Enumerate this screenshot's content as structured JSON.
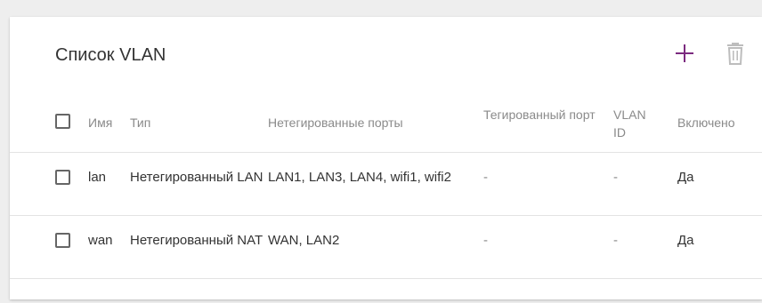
{
  "title": "Список VLAN",
  "actions": {
    "add": "plus-icon",
    "delete": "trash-icon",
    "accent_color": "#7b2a7f",
    "disabled_color": "#bdbdbd"
  },
  "table": {
    "columns": {
      "name": "Имя",
      "type": "Тип",
      "untagged": "Нетегированные порты",
      "tagged": "Тегированный порт",
      "vlan_id": "VLAN ID",
      "enabled": "Включено"
    },
    "rows": [
      {
        "name": "lan",
        "type": "Нетегированный LAN",
        "untagged": "LAN1, LAN3, LAN4, wifi1, wifi2",
        "tagged": "-",
        "vlan_id": "-",
        "enabled": "Да"
      },
      {
        "name": "wan",
        "type": "Нетегированный NAT",
        "untagged": "WAN, LAN2",
        "tagged": "-",
        "vlan_id": "-",
        "enabled": "Да"
      }
    ]
  }
}
